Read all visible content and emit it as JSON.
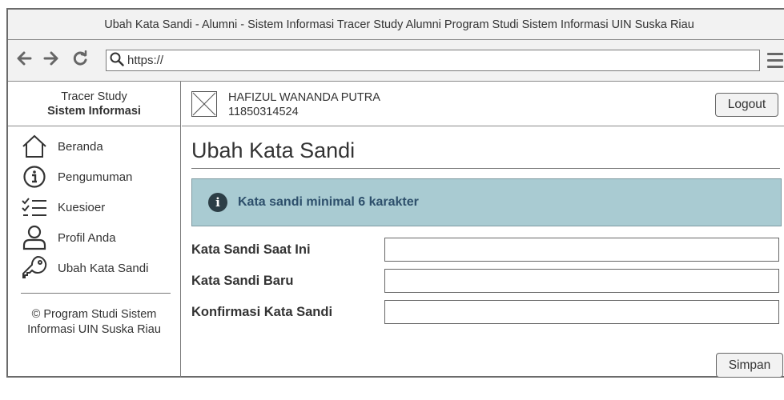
{
  "window": {
    "title": "Ubah Kata Sandi - Alumni - Sistem Informasi Tracer Study Alumni Program Studi Sistem Informasi UIN Suska Riau"
  },
  "browser": {
    "url": "https://",
    "icons": [
      "back-arrow-icon",
      "forward-arrow-icon",
      "reload-icon",
      "search-icon",
      "menu-icon"
    ]
  },
  "sidebar": {
    "brand_line1": "Tracer Study",
    "brand_line2": "Sistem Informasi",
    "items": [
      {
        "label": "Beranda",
        "icon": "home-icon"
      },
      {
        "label": "Pengumuman",
        "icon": "info-icon"
      },
      {
        "label": "Kuesioer",
        "icon": "checklist-icon"
      },
      {
        "label": "Profil Anda",
        "icon": "user-icon"
      },
      {
        "label": "Ubah Kata Sandi",
        "icon": "key-icon"
      }
    ],
    "footer": "© Program Studi Sistem Informasi UIN Suska Riau"
  },
  "header": {
    "user_name": "HAFIZUL WANANDA PUTRA",
    "user_id": "11850314524",
    "logout_label": "Logout"
  },
  "main": {
    "title": "Ubah Kata Sandi",
    "alert": "Kata sandi minimal 6 karakter",
    "fields": [
      {
        "label": "Kata Sandi Saat Ini",
        "value": ""
      },
      {
        "label": "Kata Sandi Baru",
        "value": ""
      },
      {
        "label": "Konfirmasi Kata Sandi",
        "value": ""
      }
    ],
    "save_label": "Simpan"
  },
  "colors": {
    "alert_bg": "#a9cbd2",
    "alert_text": "#2d4f6b",
    "chrome_bg": "#f2f2f2",
    "border": "#6b6b6b"
  }
}
